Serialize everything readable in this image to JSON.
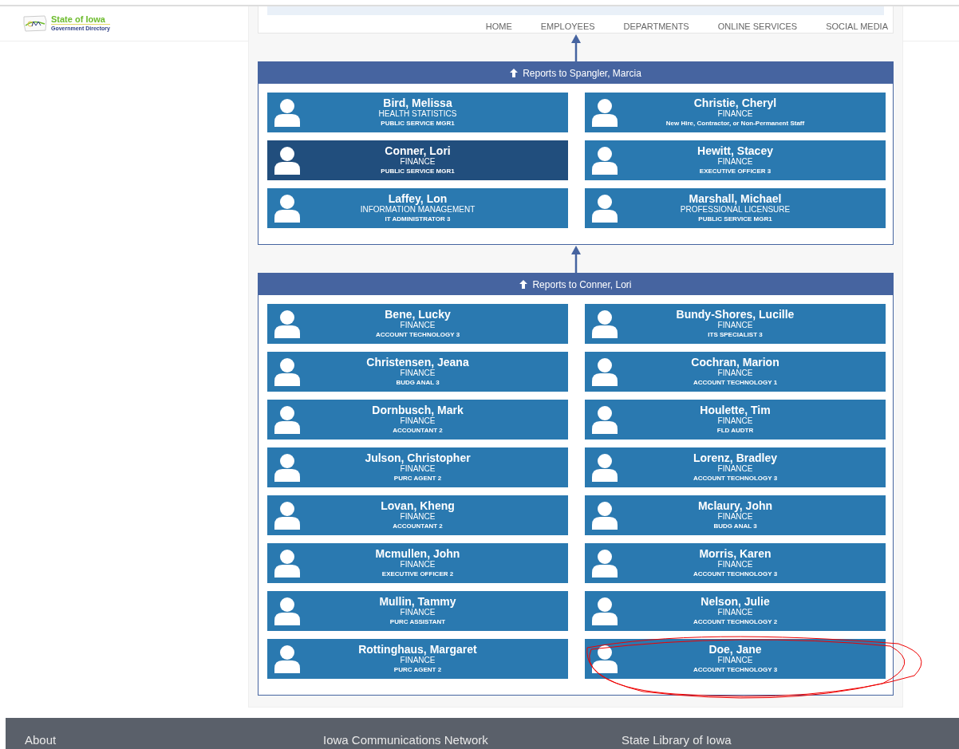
{
  "header": {
    "logo_title": "State of Iowa",
    "logo_subtitle": "Government Directory"
  },
  "nav": [
    {
      "label": "HOME"
    },
    {
      "label": "EMPLOYEES"
    },
    {
      "label": "DEPARTMENTS"
    },
    {
      "label": "ONLINE SERVICES"
    },
    {
      "label": "SOCIAL MEDIA"
    }
  ],
  "groups": [
    {
      "title": "Reports to Spangler, Marcia",
      "people": [
        {
          "name": "Bird, Melissa",
          "department": "HEALTH STATISTICS",
          "job_title": "PUBLIC SERVICE MGR1",
          "selected": false
        },
        {
          "name": "Christie, Cheryl",
          "department": "FINANCE",
          "job_title": "New Hire, Contractor, or Non-Permanent Staff",
          "selected": false
        },
        {
          "name": "Conner, Lori",
          "department": "FINANCE",
          "job_title": "PUBLIC SERVICE MGR1",
          "selected": true
        },
        {
          "name": "Hewitt, Stacey",
          "department": "FINANCE",
          "job_title": "EXECUTIVE OFFICER 3",
          "selected": false
        },
        {
          "name": "Laffey, Lon",
          "department": "INFORMATION MANAGEMENT",
          "job_title": "IT ADMINISTRATOR 3",
          "selected": false
        },
        {
          "name": "Marshall, Michael",
          "department": "PROFESSIONAL LICENSURE",
          "job_title": "PUBLIC SERVICE MGR1",
          "selected": false
        }
      ]
    },
    {
      "title": "Reports to Conner, Lori",
      "people": [
        {
          "name": "Bene, Lucky",
          "department": "FINANCE",
          "job_title": "ACCOUNT TECHNOLOGY 3",
          "selected": false
        },
        {
          "name": "Bundy-Shores, Lucille",
          "department": "FINANCE",
          "job_title": "ITS SPECIALIST 3",
          "selected": false
        },
        {
          "name": "Christensen, Jeana",
          "department": "FINANCE",
          "job_title": "BUDG ANAL 3",
          "selected": false
        },
        {
          "name": "Cochran, Marion",
          "department": "FINANCE",
          "job_title": "ACCOUNT TECHNOLOGY 1",
          "selected": false
        },
        {
          "name": "Dornbusch, Mark",
          "department": "FINANCE",
          "job_title": "ACCOUNTANT 2",
          "selected": false
        },
        {
          "name": "Houlette, Tim",
          "department": "FINANCE",
          "job_title": "FLD AUDTR",
          "selected": false
        },
        {
          "name": "Julson, Christopher",
          "department": "FINANCE",
          "job_title": "PURC AGENT 2",
          "selected": false
        },
        {
          "name": "Lorenz, Bradley",
          "department": "FINANCE",
          "job_title": "ACCOUNT TECHNOLOGY 3",
          "selected": false
        },
        {
          "name": "Lovan, Kheng",
          "department": "FINANCE",
          "job_title": "ACCOUNTANT 2",
          "selected": false
        },
        {
          "name": "Mclaury, John",
          "department": "FINANCE",
          "job_title": "BUDG ANAL 3",
          "selected": false
        },
        {
          "name": "Mcmullen, John",
          "department": "FINANCE",
          "job_title": "EXECUTIVE OFFICER 2",
          "selected": false
        },
        {
          "name": "Morris, Karen",
          "department": "FINANCE",
          "job_title": "ACCOUNT TECHNOLOGY 3",
          "selected": false
        },
        {
          "name": "Mullin, Tammy",
          "department": "FINANCE",
          "job_title": "PURC ASSISTANT",
          "selected": false
        },
        {
          "name": "Nelson, Julie",
          "department": "FINANCE",
          "job_title": "ACCOUNT TECHNOLOGY 2",
          "selected": false
        },
        {
          "name": "Rottinghaus, Margaret",
          "department": "FINANCE",
          "job_title": "PURC AGENT 2",
          "selected": false
        },
        {
          "name": "Doe, Jane",
          "department": "FINANCE",
          "job_title": "ACCOUNT TECHNOLOGY 3",
          "selected": false
        }
      ]
    }
  ],
  "footer": [
    {
      "label": "About"
    },
    {
      "label": "Iowa Communications Network"
    },
    {
      "label": "State Library of Iowa"
    }
  ]
}
